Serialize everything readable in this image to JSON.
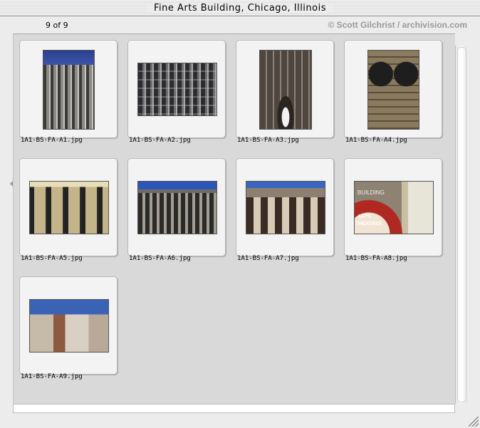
{
  "window": {
    "title": "Fine Arts Building, Chicago, Illinois"
  },
  "infobar": {
    "count": "9 of 9",
    "credit": "© Scott Gilchrist / archivision.com"
  },
  "thumbnails": [
    {
      "filename": "1A1-BS-FA-A1.jpg"
    },
    {
      "filename": "1A1-BS-FA-A2.jpg"
    },
    {
      "filename": "1A1-BS-FA-A3.jpg"
    },
    {
      "filename": "1A1-BS-FA-A4.jpg"
    },
    {
      "filename": "1A1-BS-FA-A5.jpg"
    },
    {
      "filename": "1A1-BS-FA-A6.jpg"
    },
    {
      "filename": "1A1-BS-FA-A7.jpg"
    },
    {
      "filename": "1A1-BS-FA-A8.jpg"
    },
    {
      "filename": "1A1-BS-FA-A9.jpg"
    }
  ],
  "photo_text": {
    "sign_building": "BUILDING",
    "sign_arts": "ARTS",
    "sign_theatres": "THEATRES"
  }
}
